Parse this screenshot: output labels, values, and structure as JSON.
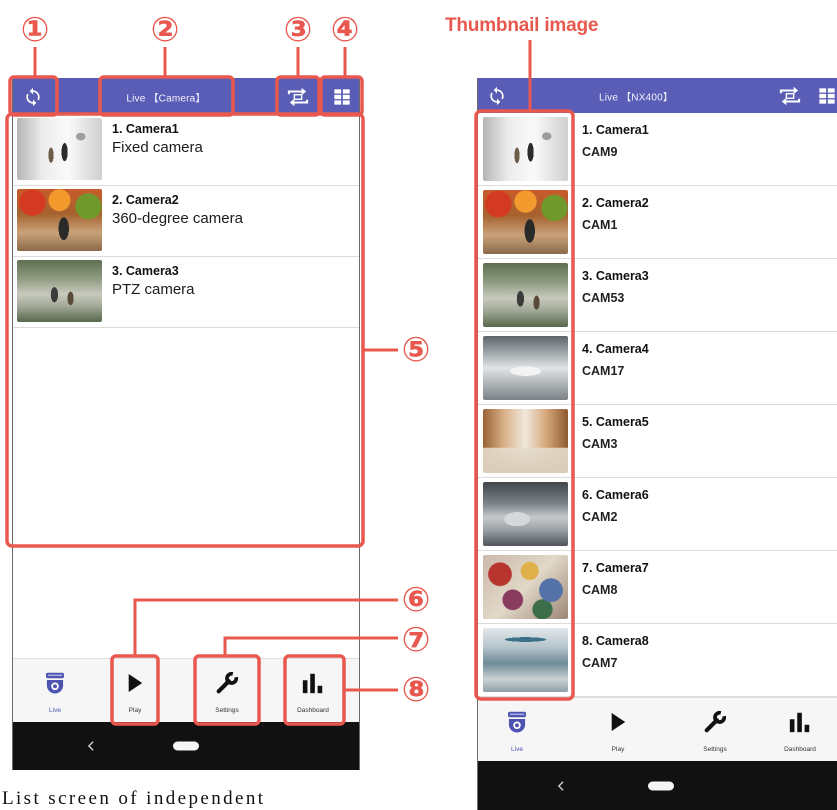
{
  "colors": {
    "header_bg": "#5a5db5",
    "callout_red": "#e8584f",
    "live_icon": "#4c54b0",
    "system_bar": "#111111"
  },
  "callouts": [
    "①",
    "②",
    "③",
    "④",
    "⑤",
    "⑥",
    "⑦",
    "⑧"
  ],
  "thumbnail_label": "Thumbnail image",
  "caption": "List screen of independent",
  "left_screen": {
    "header": {
      "refresh_icon": "sync-icon",
      "title": "Live 【Camera】",
      "switch_icon": "switch-icon",
      "layout_icon": "grid-icon"
    },
    "cameras": [
      {
        "name": "1. Camera1",
        "description": "Fixed camera"
      },
      {
        "name": "2. Camera2",
        "description": "360-degree camera"
      },
      {
        "name": "3. Camera3",
        "description": "PTZ camera"
      }
    ],
    "nav": [
      {
        "label": "Live",
        "icon": "dome-camera-icon",
        "active": true
      },
      {
        "label": "Play",
        "icon": "play-icon"
      },
      {
        "label": "Settings",
        "icon": "wrench-icon"
      },
      {
        "label": "Dashboard",
        "icon": "bar-chart-icon"
      }
    ],
    "system_nav": {
      "back_icon": "back-icon",
      "home_icon": "home-pill-icon"
    }
  },
  "right_screen": {
    "header": {
      "refresh_icon": "sync-icon",
      "title": "Live 【NX400】",
      "switch_icon": "switch-icon",
      "layout_icon": "grid-icon"
    },
    "cameras": [
      {
        "name": "1. Camera1",
        "id": "CAM9"
      },
      {
        "name": "2. Camera2",
        "id": "CAM1"
      },
      {
        "name": "3. Camera3",
        "id": "CAM53"
      },
      {
        "name": "4. Camera4",
        "id": "CAM17"
      },
      {
        "name": "5. Camera5",
        "id": "CAM3"
      },
      {
        "name": "6. Camera6",
        "id": "CAM2"
      },
      {
        "name": "7. Camera7",
        "id": "CAM8"
      },
      {
        "name": "8. Camera8",
        "id": "CAM7"
      }
    ],
    "nav": [
      {
        "label": "Live",
        "icon": "dome-camera-icon",
        "active": true
      },
      {
        "label": "Play",
        "icon": "play-icon"
      },
      {
        "label": "Settings",
        "icon": "wrench-icon"
      },
      {
        "label": "Dashboard",
        "icon": "bar-chart-icon"
      }
    ],
    "system_nav": {
      "back_icon": "back-icon",
      "home_icon": "home-pill-icon"
    }
  }
}
